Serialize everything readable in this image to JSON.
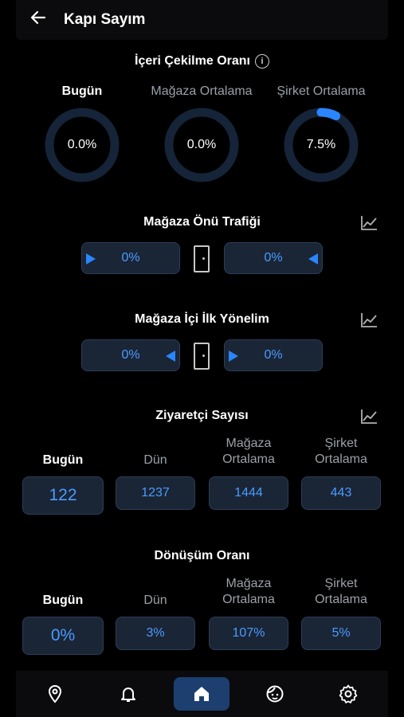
{
  "header": {
    "title": "Kapı Sayım",
    "back_icon": "arrow-left-icon"
  },
  "pull_in_rate": {
    "title": "İçeri Çekilme Oranı",
    "info_icon": "i",
    "rings": [
      {
        "label": "Bugün",
        "value": "0.0%",
        "fraction": 0.0,
        "active": true
      },
      {
        "label": "Mağaza Ortalama",
        "value": "0.0%",
        "fraction": 0.0,
        "active": false
      },
      {
        "label": "Şirket Ortalama",
        "value": "7.5%",
        "fraction": 0.075,
        "active": false
      }
    ]
  },
  "store_front_traffic": {
    "title": "Mağaza Önü Trafiği",
    "left_value": "0%",
    "right_value": "0%"
  },
  "store_first_direction": {
    "title": "Mağaza İçi İlk Yönelim",
    "left_value": "0%",
    "right_value": "0%"
  },
  "visitor_count": {
    "title": "Ziyaretçi Sayısı",
    "columns": [
      {
        "label": "Bugün",
        "value": "122"
      },
      {
        "label": "Dün",
        "value": "1237"
      },
      {
        "label": "Mağaza Ortalama",
        "value": "1444"
      },
      {
        "label": "Şirket Ortalama",
        "value": "443"
      }
    ]
  },
  "conversion_rate": {
    "title": "Dönüşüm Oranı",
    "columns": [
      {
        "label": "Bugün",
        "value": "0%"
      },
      {
        "label": "Dün",
        "value": "3%"
      },
      {
        "label": "Mağaza Ortalama",
        "value": "107%"
      },
      {
        "label": "Şirket Ortalama",
        "value": "5%"
      }
    ]
  },
  "bottom_nav": {
    "items": [
      "location-pin-icon",
      "bell-icon",
      "home-icon",
      "face-icon",
      "gear-icon"
    ],
    "active_index": 2
  },
  "colors": {
    "accent": "#2a85ff",
    "ring_track": "#152438",
    "box_bg": "#1a2536",
    "box_border": "#2c3d58",
    "value_text": "#4a9cff",
    "nav_active": "#1d3f70"
  }
}
